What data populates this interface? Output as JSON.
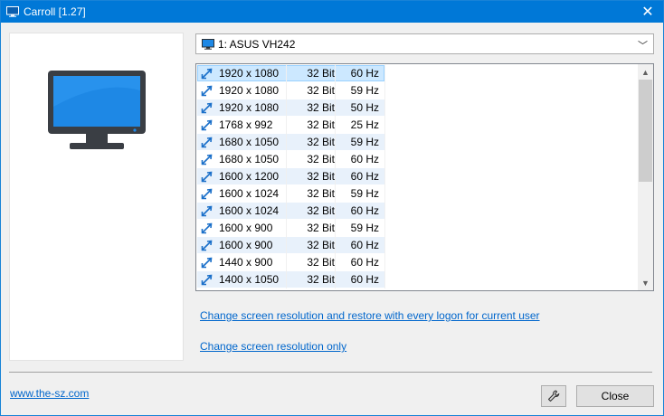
{
  "window": {
    "title": "Carroll [1.27]",
    "icons": {
      "app": "monitor-icon",
      "close": "close-icon"
    }
  },
  "monitor_select": {
    "selected": "1: ASUS VH242",
    "icon": "monitor-icon"
  },
  "resolution_list": {
    "selected_index": 0,
    "rows": [
      {
        "resolution": "1920 x 1080",
        "bits": "32 Bit",
        "hz": "60 Hz"
      },
      {
        "resolution": "1920 x 1080",
        "bits": "32 Bit",
        "hz": "59 Hz"
      },
      {
        "resolution": "1920 x 1080",
        "bits": "32 Bit",
        "hz": "50 Hz"
      },
      {
        "resolution": "1768 x 992",
        "bits": "32 Bit",
        "hz": "25 Hz"
      },
      {
        "resolution": "1680 x 1050",
        "bits": "32 Bit",
        "hz": "59 Hz"
      },
      {
        "resolution": "1680 x 1050",
        "bits": "32 Bit",
        "hz": "60 Hz"
      },
      {
        "resolution": "1600 x 1200",
        "bits": "32 Bit",
        "hz": "60 Hz"
      },
      {
        "resolution": "1600 x 1024",
        "bits": "32 Bit",
        "hz": "59 Hz"
      },
      {
        "resolution": "1600 x 1024",
        "bits": "32 Bit",
        "hz": "60 Hz"
      },
      {
        "resolution": "1600 x 900",
        "bits": "32 Bit",
        "hz": "59 Hz"
      },
      {
        "resolution": "1600 x 900",
        "bits": "32 Bit",
        "hz": "60 Hz"
      },
      {
        "resolution": "1440 x 900",
        "bits": "32 Bit",
        "hz": "60 Hz"
      },
      {
        "resolution": "1400 x 1050",
        "bits": "32 Bit",
        "hz": "60 Hz"
      }
    ]
  },
  "links": {
    "change_and_restore": "Change screen resolution and restore with every logon for current user",
    "change_only": "Change screen resolution only",
    "website": "www.the-sz.com"
  },
  "buttons": {
    "close": "Close",
    "settings_icon": "wrench-icon"
  },
  "colors": {
    "titlebar": "#0078d7",
    "link": "#0066cc",
    "selected_row": "#cce8ff",
    "alt_row": "#e8f1fb"
  }
}
